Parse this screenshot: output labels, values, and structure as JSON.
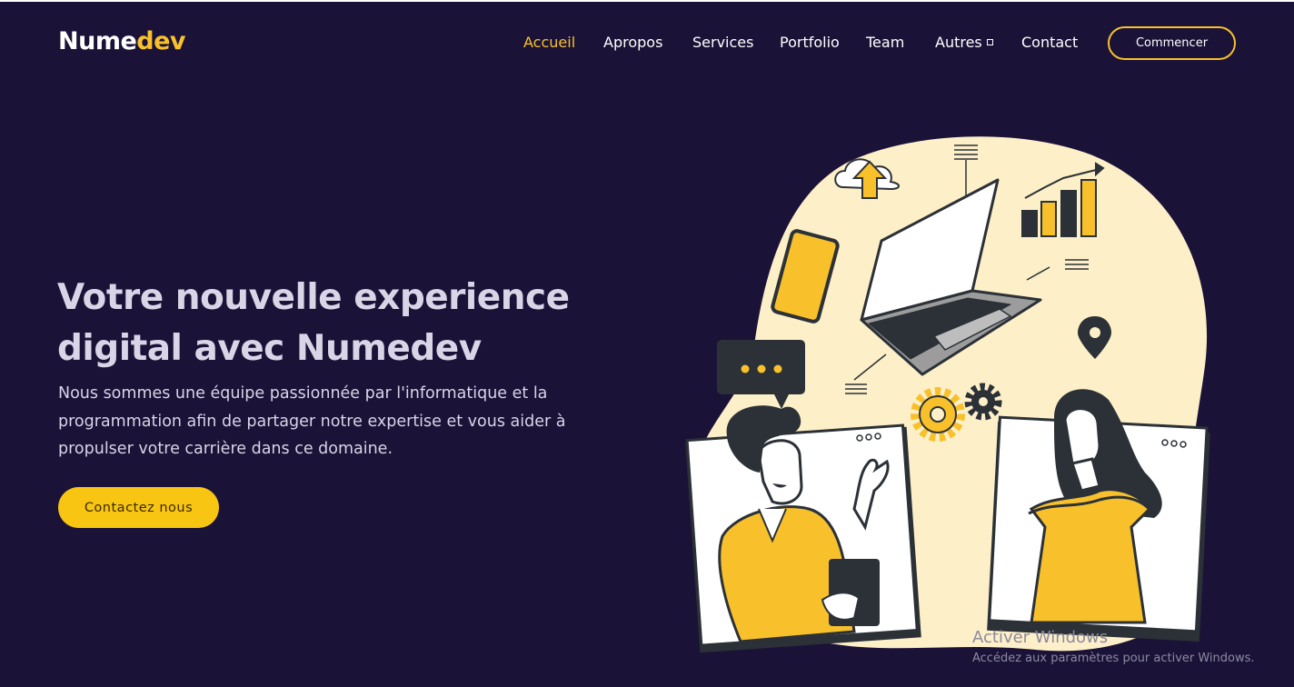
{
  "brand": {
    "part1": "Nume",
    "part2": "dev",
    "accent": "#f8c12c"
  },
  "nav": {
    "items": [
      {
        "label": "Accueil",
        "active": true
      },
      {
        "label": "Apropos"
      },
      {
        "label": "Services"
      },
      {
        "label": "Portfolio"
      },
      {
        "label": "Team"
      },
      {
        "label": "Autres",
        "has_dropdown": true
      },
      {
        "label": "Contact"
      }
    ],
    "cta": "Commencer"
  },
  "hero": {
    "title_line1": "Votre nouvelle experience",
    "title_line2": "digital avec Numedev",
    "text": "Nous sommes une équipe passionnée par l'informatique et la programmation afin de partager notre expertise et vous aider à propulser votre carrière dans ce domaine.",
    "button": "Contactez nous"
  },
  "watermark": {
    "title": "Activer Windows",
    "subtitle": "Accédez aux paramètres pour activer Windows."
  },
  "colors": {
    "background": "#1b1238",
    "accent": "#f8c12c",
    "blob": "#fdefc8",
    "dark": "#2b3137"
  }
}
